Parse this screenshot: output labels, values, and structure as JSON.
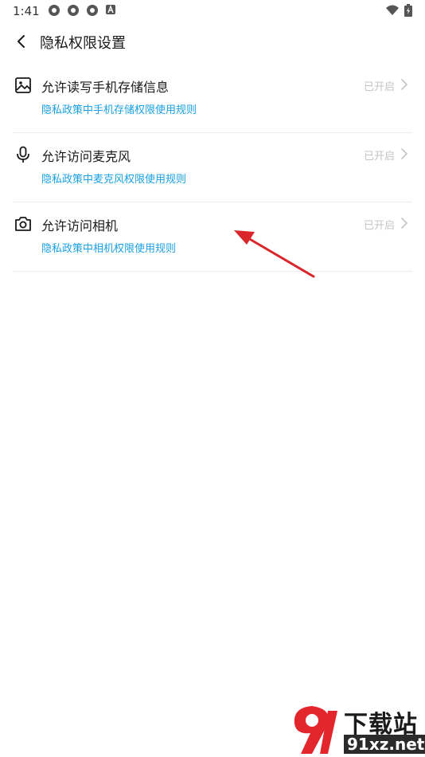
{
  "status_bar": {
    "time": "1:41",
    "icons": [
      "notification-app-icon",
      "notification-app-icon",
      "notification-app-icon",
      "notification-a-icon"
    ],
    "right_icons": [
      "wifi-icon",
      "battery-icon"
    ]
  },
  "header": {
    "back_icon": "chevron-left-icon",
    "title": "隐私权限设置"
  },
  "permissions": [
    {
      "icon": "image-icon",
      "title": "允许读写手机存储信息",
      "link": "隐私政策中手机存储权限使用规则",
      "status": "已开启"
    },
    {
      "icon": "microphone-icon",
      "title": "允许访问麦克风",
      "link": "隐私政策中麦克风权限使用规则",
      "status": "已开启"
    },
    {
      "icon": "camera-icon",
      "title": "允许访问相机",
      "link": "隐私政策中相机权限使用规则",
      "status": "已开启"
    }
  ],
  "colors": {
    "link": "#1aa0e0",
    "status": "#c4c4c4",
    "divider": "#ededed",
    "annotation_arrow": "#d9262b"
  },
  "watermark": {
    "brand": "下载站",
    "domain": "91xz.net"
  }
}
